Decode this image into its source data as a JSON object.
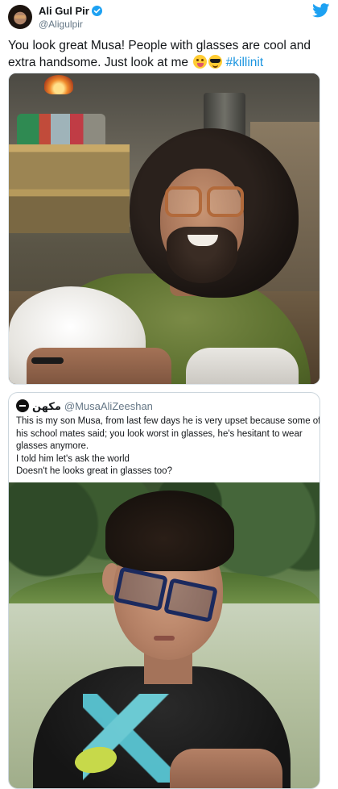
{
  "tweet": {
    "author": {
      "display_name": "Ali Gul Pir",
      "handle": "@Aligulpir",
      "verified": true
    },
    "text_main": "You look great Musa! People with glasses are cool and extra handsome. Just look at me ",
    "emojis": [
      "face-savoring-food",
      "smiling-face-with-sunglasses"
    ],
    "hashtag": "#killinit",
    "media": {
      "type": "photo",
      "subject": "man-with-glasses"
    }
  },
  "quoted_tweet": {
    "author": {
      "display_name": "مکھن",
      "handle": "@MusaAliZeeshan"
    },
    "text_lines": [
      "This is my son Musa, from last few days he is very upset because some of",
      "his school mates said; you look worst in glasses, he's hesitant to wear",
      "glasses anymore.",
      "I told him let's ask the world",
      "Doesn't he looks great in glasses too?"
    ],
    "media": {
      "type": "photo",
      "subject": "boy-with-glasses"
    }
  },
  "colors": {
    "brand_blue": "#1da1f2",
    "link_blue": "#1b95e0",
    "text": "#14171a",
    "secondary_text": "#657786",
    "border": "#ccd6dd"
  },
  "icons": [
    "twitter-bird-icon",
    "verified-badge-icon"
  ]
}
